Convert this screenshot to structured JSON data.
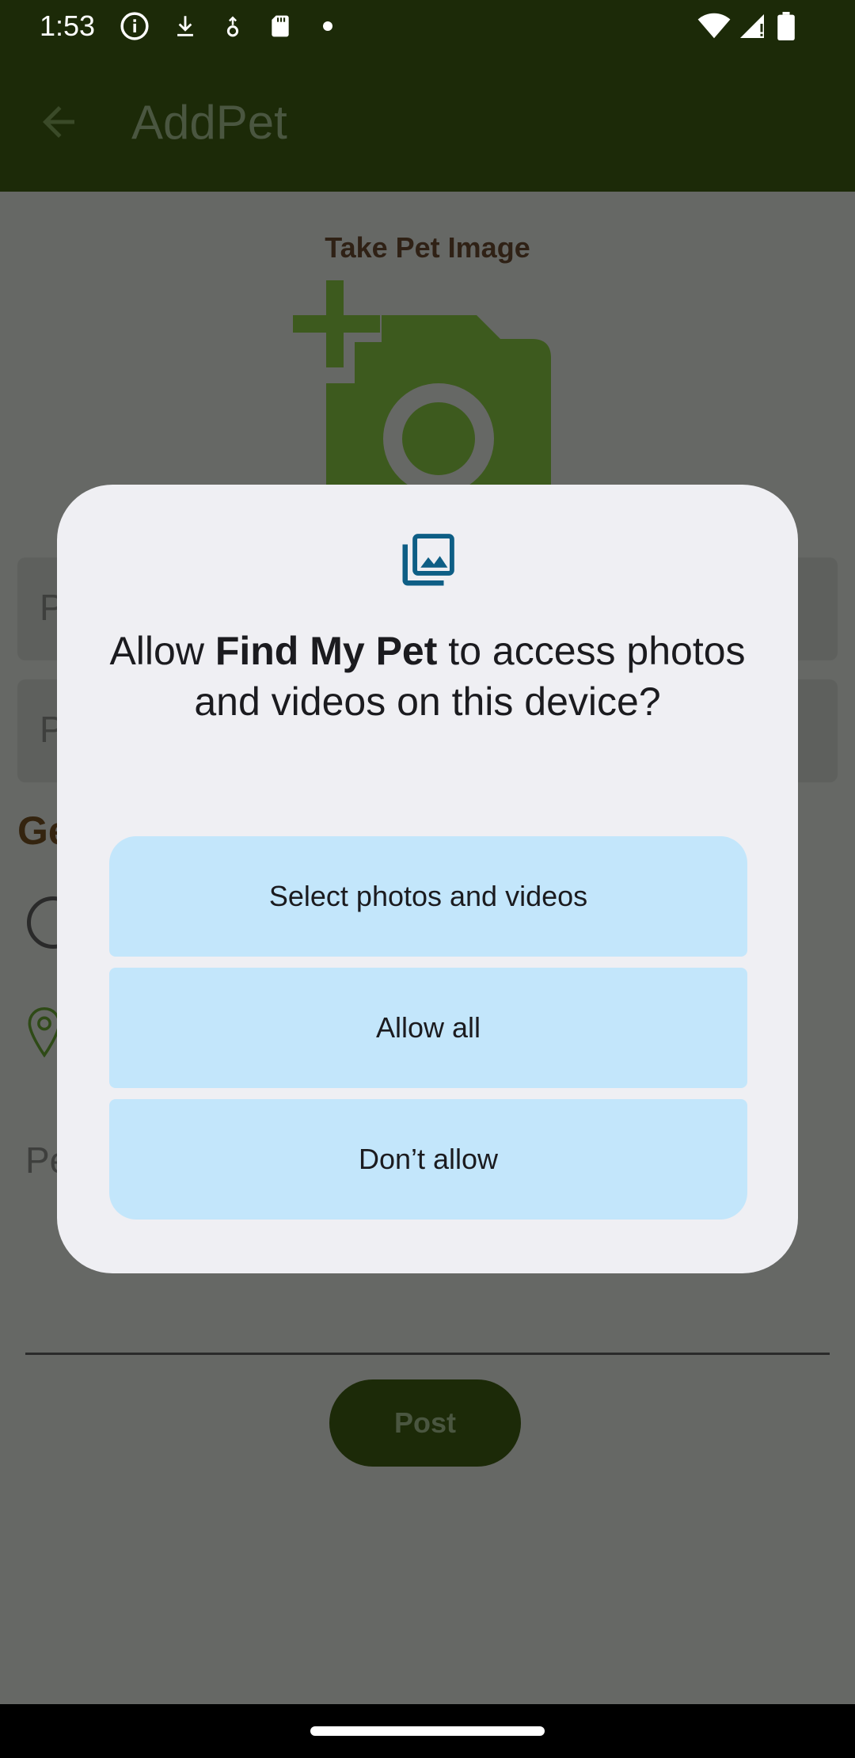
{
  "status_bar": {
    "time": "1:53",
    "left_icons": [
      "info-icon",
      "download-icon",
      "download-alt-icon",
      "sd-card-icon",
      "dot-icon"
    ],
    "right_icons": [
      "wifi-icon",
      "signal-icon",
      "battery-icon"
    ]
  },
  "app_bar": {
    "back_icon": "arrow-back-icon",
    "title": "AddPet"
  },
  "app_content": {
    "take_image_label": "Take Pet Image",
    "camera_icon": "add-a-photo-icon",
    "field1_stub": "P",
    "field2_stub": "P",
    "gender_stub": "Ge",
    "location_icon": "location-pin-icon",
    "pe_stub": "Pe",
    "post_label": "Post"
  },
  "dialog": {
    "icon": "photo-library-icon",
    "title_prefix": "Allow ",
    "app_name": "Find My Pet",
    "title_suffix": " to access photos and videos on this device?",
    "buttons": {
      "select": "Select photos and videos",
      "allow_all": "Allow all",
      "deny": "Don’t allow"
    }
  },
  "colors": {
    "app_bar": "#1c2a08",
    "accent_green": "#3d5a1e",
    "dialog_bg": "#efeff3",
    "button_bg": "#c3e6fb",
    "dialog_icon": "#0e5e85"
  }
}
